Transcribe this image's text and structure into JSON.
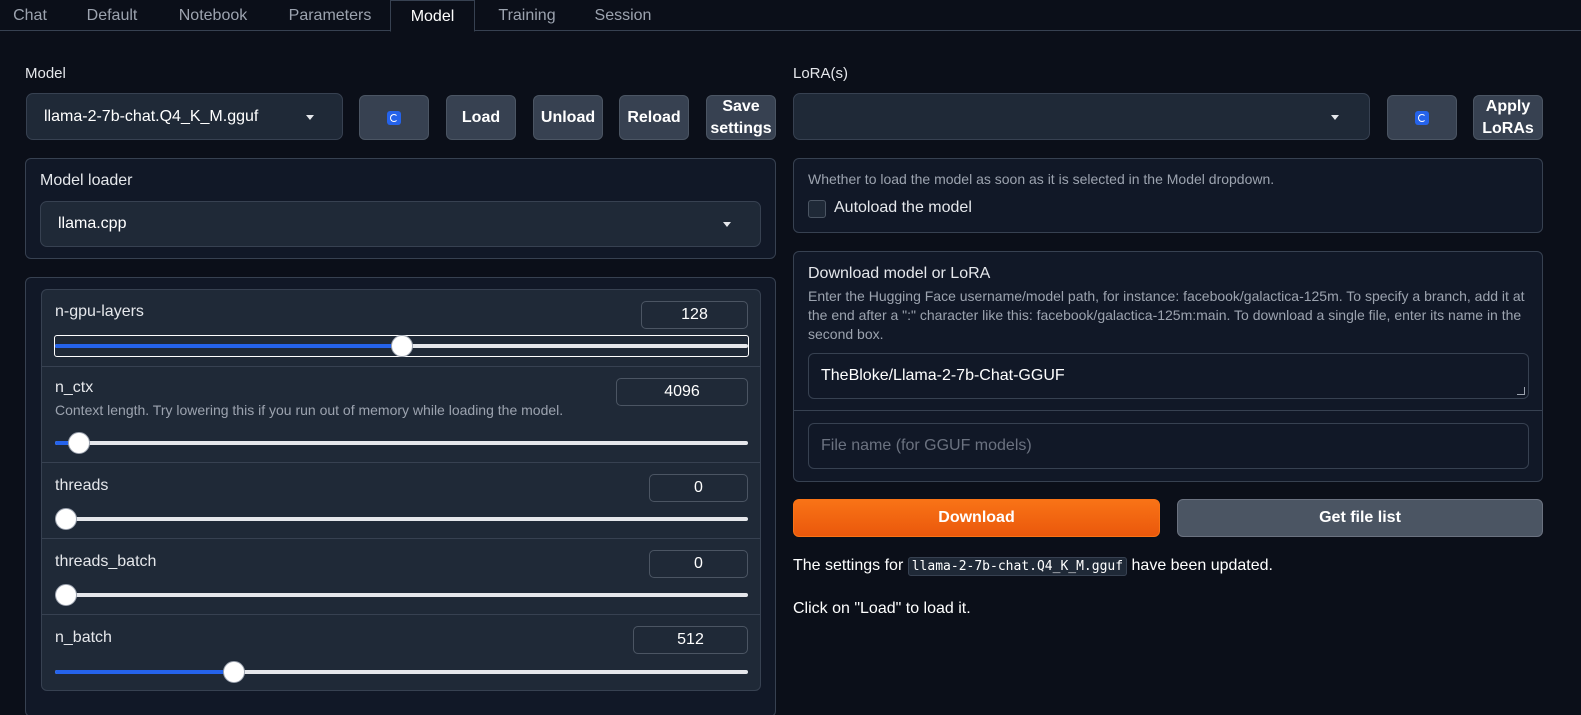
{
  "tabs": [
    {
      "label": "Chat"
    },
    {
      "label": "Default"
    },
    {
      "label": "Notebook"
    },
    {
      "label": "Parameters"
    },
    {
      "label": "Model"
    },
    {
      "label": "Training"
    },
    {
      "label": "Session"
    }
  ],
  "active_tab": "Model",
  "model": {
    "label": "Model",
    "selected": "llama-2-7b-chat.Q4_K_M.gguf",
    "buttons": {
      "refresh_icon": "refresh-icon",
      "load": "Load",
      "unload": "Unload",
      "reload": "Reload",
      "save_settings_line1": "Save",
      "save_settings_line2": "settings"
    }
  },
  "lora": {
    "label": "LoRA(s)",
    "selected": "",
    "apply_line1": "Apply",
    "apply_line2": "LoRAs"
  },
  "loader": {
    "label": "Model loader",
    "selected": "llama.cpp"
  },
  "sliders": [
    {
      "name": "n-gpu-layers",
      "value": "128",
      "fraction": 0.5,
      "info": ""
    },
    {
      "name": "n_ctx",
      "value": "4096",
      "fraction": 0.02,
      "info": "Context length. Try lowering this if you run out of memory while loading the model."
    },
    {
      "name": "threads",
      "value": "0",
      "fraction": 0.0,
      "info": ""
    },
    {
      "name": "threads_batch",
      "value": "0",
      "fraction": 0.0,
      "info": ""
    },
    {
      "name": "n_batch",
      "value": "512",
      "fraction": 0.25,
      "info": ""
    }
  ],
  "autoload": {
    "help": "Whether to load the model as soon as it is selected in the Model dropdown.",
    "label": "Autoload the model",
    "checked": false
  },
  "download": {
    "title": "Download model or LoRA",
    "help": "Enter the Hugging Face username/model path, for instance: facebook/galactica-125m. To specify a branch, add it at the end after a \":\" character like this: facebook/galactica-125m:main. To download a single file, enter its name in the second box.",
    "repo_value": "TheBloke/Llama-2-7b-Chat-GGUF",
    "file_placeholder": "File name (for GGUF models)",
    "download_button": "Download",
    "file_list_button": "Get file list"
  },
  "status": {
    "prefix": "The settings for",
    "model_code": "llama-2-7b-chat.Q4_K_M.gguf",
    "suffix": "have been updated.",
    "hint": "Click on \"Load\" to load it."
  },
  "colors": {
    "accent_blue": "#2563eb",
    "download_orange": "#f97316",
    "background": "#0b0f19"
  }
}
